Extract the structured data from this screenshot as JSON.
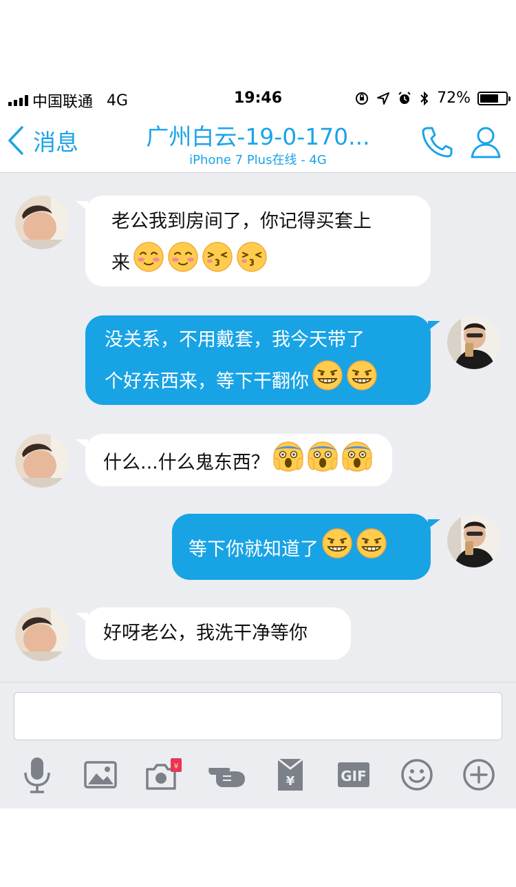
{
  "status_bar": {
    "carrier": "中国联通",
    "network": "4G",
    "time": "19:46",
    "battery_percent": "72%",
    "battery_level": 0.72
  },
  "nav": {
    "back_label": "消息",
    "title": "广州白云-19-0-170...",
    "subtitle": "iPhone 7 Plus在线 - 4G"
  },
  "messages": [
    {
      "side": "left",
      "text_line1": "老公我到房间了，你记得买套上",
      "text_line2": "来",
      "emojis": [
        "blush",
        "blush",
        "kiss",
        "kiss"
      ]
    },
    {
      "side": "right",
      "text_line1": "没关系，不用戴套，我今天带了",
      "text_line2": "个好东西来，等下干翻你",
      "emojis": [
        "grin",
        "grin"
      ]
    },
    {
      "side": "left",
      "text_line1": "什么...什么鬼东西？",
      "emojis": [
        "scream",
        "scream",
        "scream"
      ]
    },
    {
      "side": "right",
      "text_line1": "等下你就知道了",
      "emojis": [
        "grin",
        "grin"
      ]
    },
    {
      "side": "left",
      "text_line1": "好呀老公，我洗干净等你"
    }
  ],
  "toolbar": {
    "icons": [
      "microphone-icon",
      "image-icon",
      "camera-icon",
      "poke-icon",
      "red-packet-icon",
      "gif-icon",
      "emoji-icon",
      "plus-icon"
    ],
    "gif_label": "GIF",
    "red_packet_symbol": "¥"
  },
  "colors": {
    "accent": "#1aa3e8",
    "bubble_right": "#18a3e5",
    "bubble_left": "#ffffff",
    "background": "#ebedf1",
    "icon_gray": "#7c8088"
  }
}
